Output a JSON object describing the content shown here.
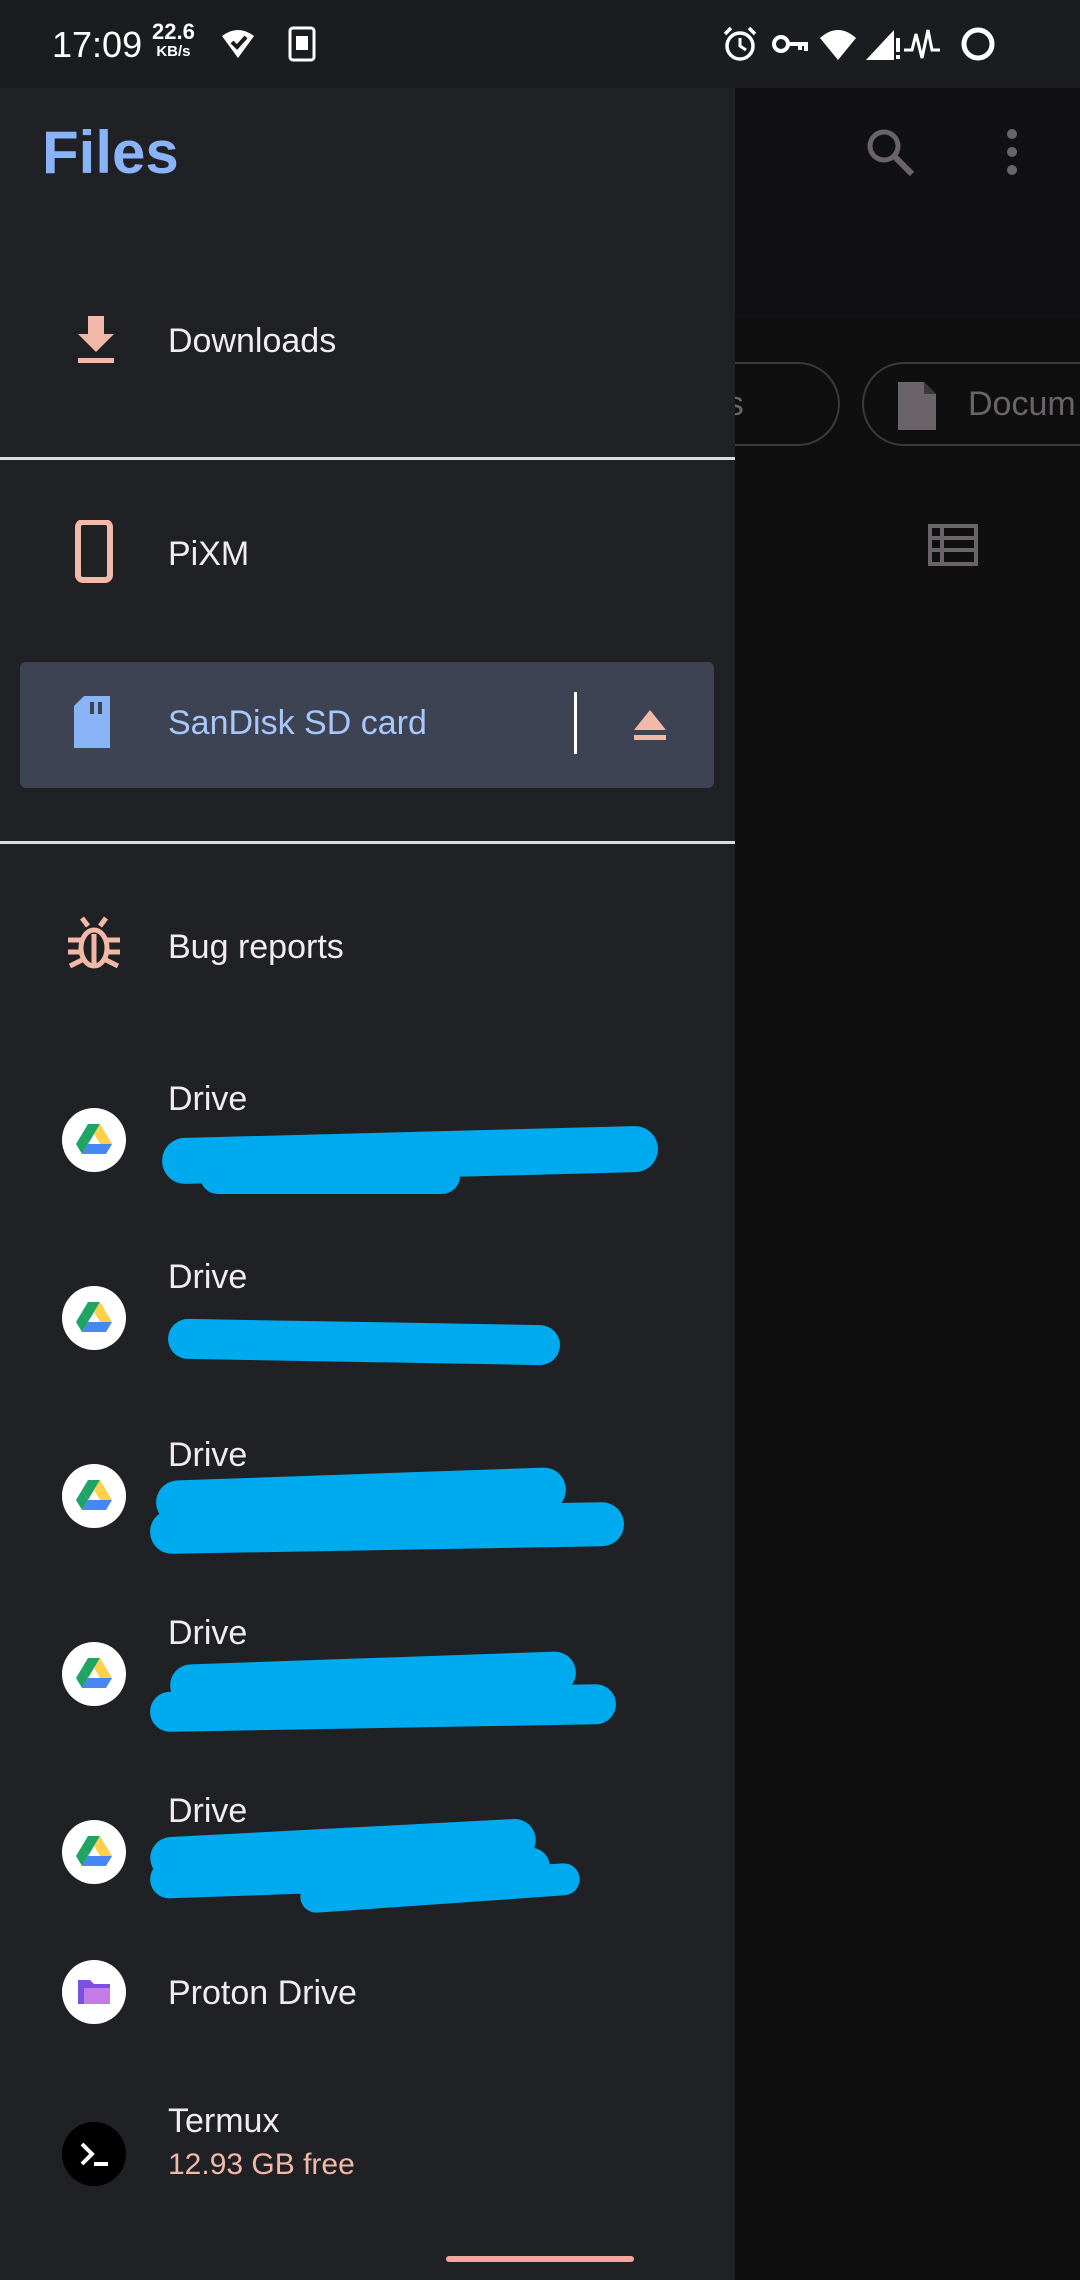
{
  "status_bar": {
    "time": "17:09",
    "speed_value": "22.6",
    "speed_unit": "KB/s",
    "icons": [
      "vpn-check-icon",
      "sim-card-icon",
      "alarm-icon",
      "key-icon",
      "wifi-icon",
      "signal-icon",
      "activity-icon",
      "battery-ring-icon"
    ]
  },
  "background_app": {
    "chips": [
      "deos",
      "Docum"
    ],
    "icons": [
      "search-icon",
      "more-vert-icon",
      "document-icon",
      "list-view-icon"
    ]
  },
  "drawer": {
    "title": "Files",
    "items": [
      {
        "label": "Downloads",
        "icon": "download-icon"
      },
      {
        "label": "PiXM",
        "icon": "phone-icon"
      },
      {
        "label": "SanDisk SD card",
        "icon": "sd-card-icon",
        "selected": true,
        "action_icon": "eject-icon"
      },
      {
        "label": "Bug reports",
        "icon": "bug-icon"
      },
      {
        "label": "Drive",
        "icon": "google-drive-icon"
      },
      {
        "label": "Drive",
        "icon": "google-drive-icon"
      },
      {
        "label": "Drive",
        "icon": "google-drive-icon"
      },
      {
        "label": "Drive",
        "icon": "google-drive-icon"
      },
      {
        "label": "Drive",
        "icon": "google-drive-icon"
      },
      {
        "label": "Proton Drive",
        "icon": "proton-drive-icon"
      },
      {
        "label": "Termux",
        "subtitle": "12.93 GB free",
        "icon": "terminal-icon"
      }
    ]
  },
  "colors": {
    "drawer_bg": "#202124",
    "accent_blue": "#8ab4f8",
    "selected_bg": "#3d4352",
    "icon_pink": "#f2b8a8",
    "redaction": "#00aaee"
  }
}
